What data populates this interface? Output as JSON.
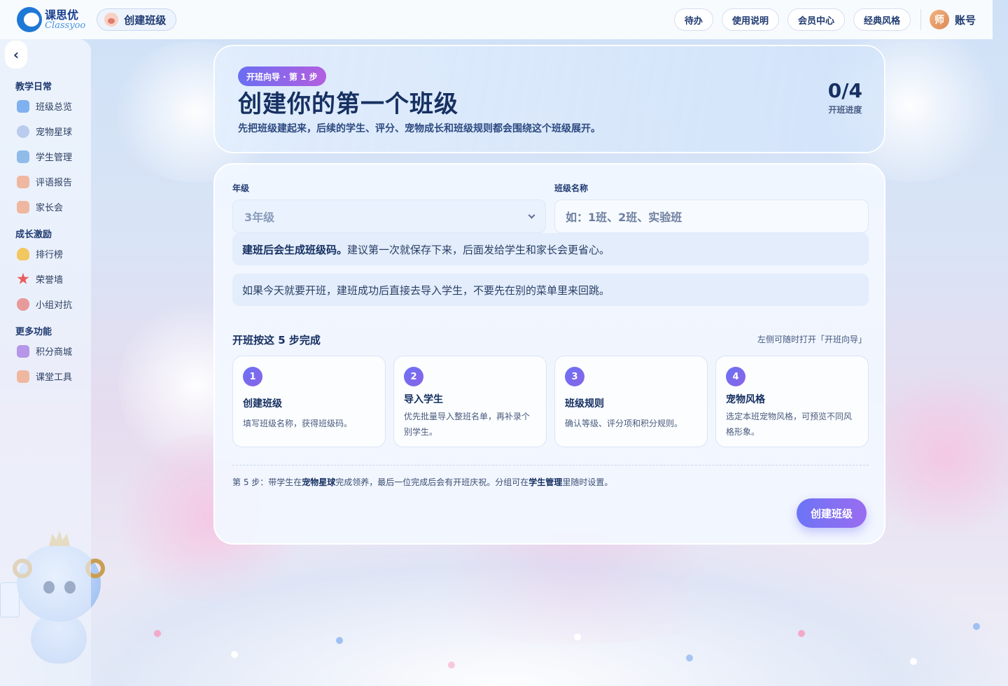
{
  "topbar": {
    "logo_cn": "课思优",
    "logo_en": "Classyoo",
    "current_page": "创建班级",
    "actions": [
      "待办",
      "使用说明",
      "会员中心",
      "经典风格"
    ],
    "avatar_char": "师",
    "account_label": "账号"
  },
  "sidebar": {
    "sections": [
      {
        "title": "教学日常",
        "items": [
          "班级总览",
          "宠物星球",
          "学生管理",
          "评语报告",
          "家长会"
        ]
      },
      {
        "title": "成长激励",
        "items": [
          "排行榜",
          "荣誉墙",
          "小组对抗"
        ]
      },
      {
        "title": "更多功能",
        "items": [
          "积分商城",
          "课堂工具"
        ]
      }
    ]
  },
  "hero": {
    "badge": "开班向导 · 第 1 步",
    "title": "创建你的第一个班级",
    "subtitle": "先把班级建起来，后续的学生、评分、宠物成长和班级规则都会围绕这个班级展开。",
    "progress_value": "0/4",
    "progress_label": "开班进度"
  },
  "form": {
    "grade_label": "年级",
    "grade_value": "3年级",
    "class_label": "班级名称",
    "class_placeholder": "如：1班、2班、实验班",
    "note1_bold": "建班后会生成班级码。",
    "note1_text": "建议第一次就保存下来，后面发给学生和家长会更省心。",
    "note2_text": "如果今天就要开班，建班成功后直接去导入学生，不要先在别的菜单里来回跳。"
  },
  "steps": {
    "heading": "开班按这 5 步完成",
    "hint": "左侧可随时打开「开班向导」",
    "items": [
      {
        "num": "1",
        "title": "创建班级",
        "desc": "填写班级名称，获得班级码。"
      },
      {
        "num": "2",
        "title": "导入学生",
        "desc": "优先批量导入整班名单，再补录个别学生。"
      },
      {
        "num": "3",
        "title": "班级规则",
        "desc": "确认等级、评分项和积分规则。"
      },
      {
        "num": "4",
        "title": "宠物风格",
        "desc": "选定本班宠物风格，可预览不同风格形象。"
      }
    ],
    "footnote_pre": "第 5 步：带学生在",
    "footnote_b1": "宠物星球",
    "footnote_mid": "完成领养，最后一位完成后会有开班庆祝。分组可在",
    "footnote_b2": "学生管理",
    "footnote_post": "里随时设置。"
  },
  "submit_label": "创建班级"
}
